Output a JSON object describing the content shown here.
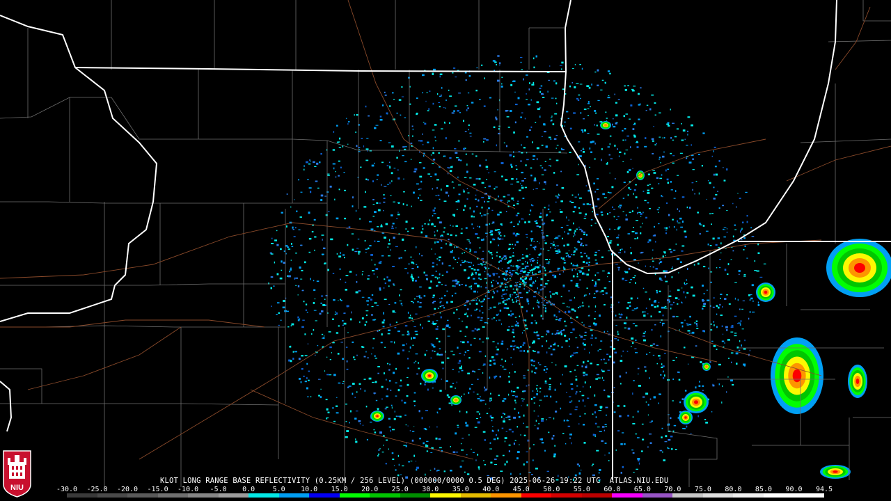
{
  "product": {
    "title_line": "KLOT LONG RANGE BASE REFLECTIVITY (0.25KM / 256 LEVEL) (000000/0000 0.5 DEG) 2025-06-26 19:22 UTC  ATLAS.NIU.EDU"
  },
  "logo": {
    "text": "NIU"
  },
  "color_scale": {
    "labels": [
      "-30.0",
      "-25.0",
      "-20.0",
      "-15.0",
      "-10.0",
      "-5.0",
      "0.0",
      "5.0",
      "10.0",
      "15.0",
      "20.0",
      "25.0",
      "30.0",
      "35.0",
      "40.0",
      "45.0",
      "50.0",
      "55.0",
      "60.0",
      "65.0",
      "70.0",
      "75.0",
      "80.0",
      "85.0",
      "90.0",
      "94.5"
    ],
    "colors": [
      "#3a3a3a",
      "#4a4a4a",
      "#5a5a5a",
      "#707070",
      "#868686",
      "#9c9c9c",
      "#04e9e7",
      "#019ff4",
      "#0300f4",
      "#02fd02",
      "#01c501",
      "#008e00",
      "#fdf802",
      "#e5bc00",
      "#fd9500",
      "#fd0000",
      "#d40000",
      "#bc0000",
      "#f800fd",
      "#9854c6",
      "#c8c8c8",
      "#e0e0e0",
      "#f0f0f0",
      "#ffffff",
      "#ffffff"
    ]
  }
}
